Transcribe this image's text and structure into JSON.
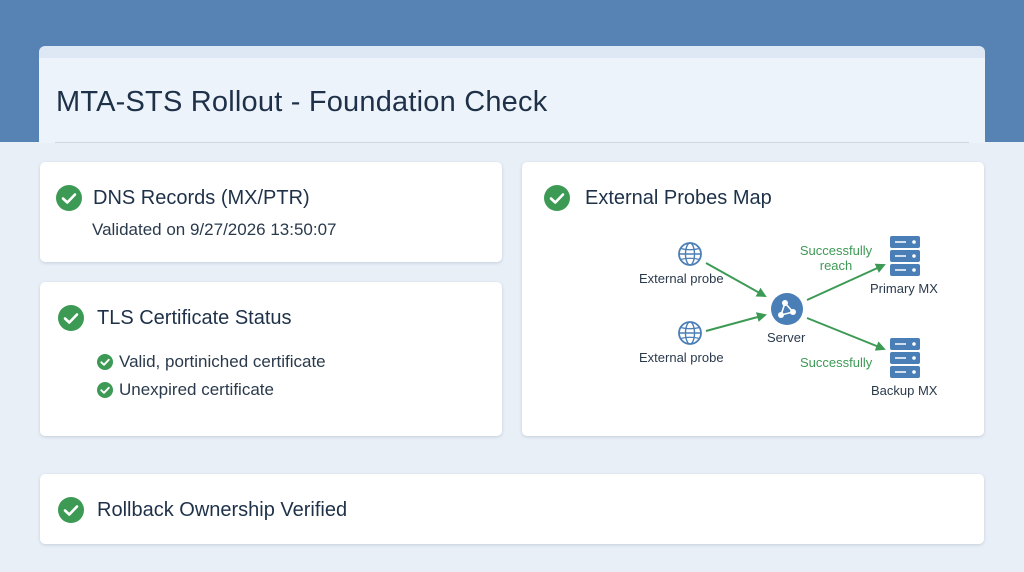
{
  "page": {
    "title": "MTA-STS Rollout - Foundation Check"
  },
  "colors": {
    "header_band": "#5782b4",
    "background": "#e8eff7",
    "success_green": "#3d9a55",
    "server_blue": "#4a7eb6"
  },
  "dns_card": {
    "title": "DNS Records (MX/PTR)",
    "subtitle": "Validated on 9/27/2026 13:50:07",
    "status_icon": "check-circle-icon"
  },
  "tls_card": {
    "title": "TLS Certificate Status",
    "status_icon": "check-circle-icon",
    "items": [
      {
        "label": "Valid, portiniched certificate"
      },
      {
        "label": "Unexpired certificate"
      }
    ]
  },
  "map_card": {
    "title": "External Probes Map",
    "status_icon": "check-circle-icon",
    "nodes": {
      "probe_1": "External probe",
      "probe_2": "External probe",
      "server": "Server",
      "primary_mx": "Primary MX",
      "backup_mx": "Backup MX"
    },
    "edge_labels": {
      "to_primary_line1": "Successfully",
      "to_primary_line2": "reach",
      "to_backup": "Successfully"
    }
  },
  "rollback_card": {
    "title": "Rollback Ownership Verified",
    "status_icon": "check-circle-icon"
  }
}
